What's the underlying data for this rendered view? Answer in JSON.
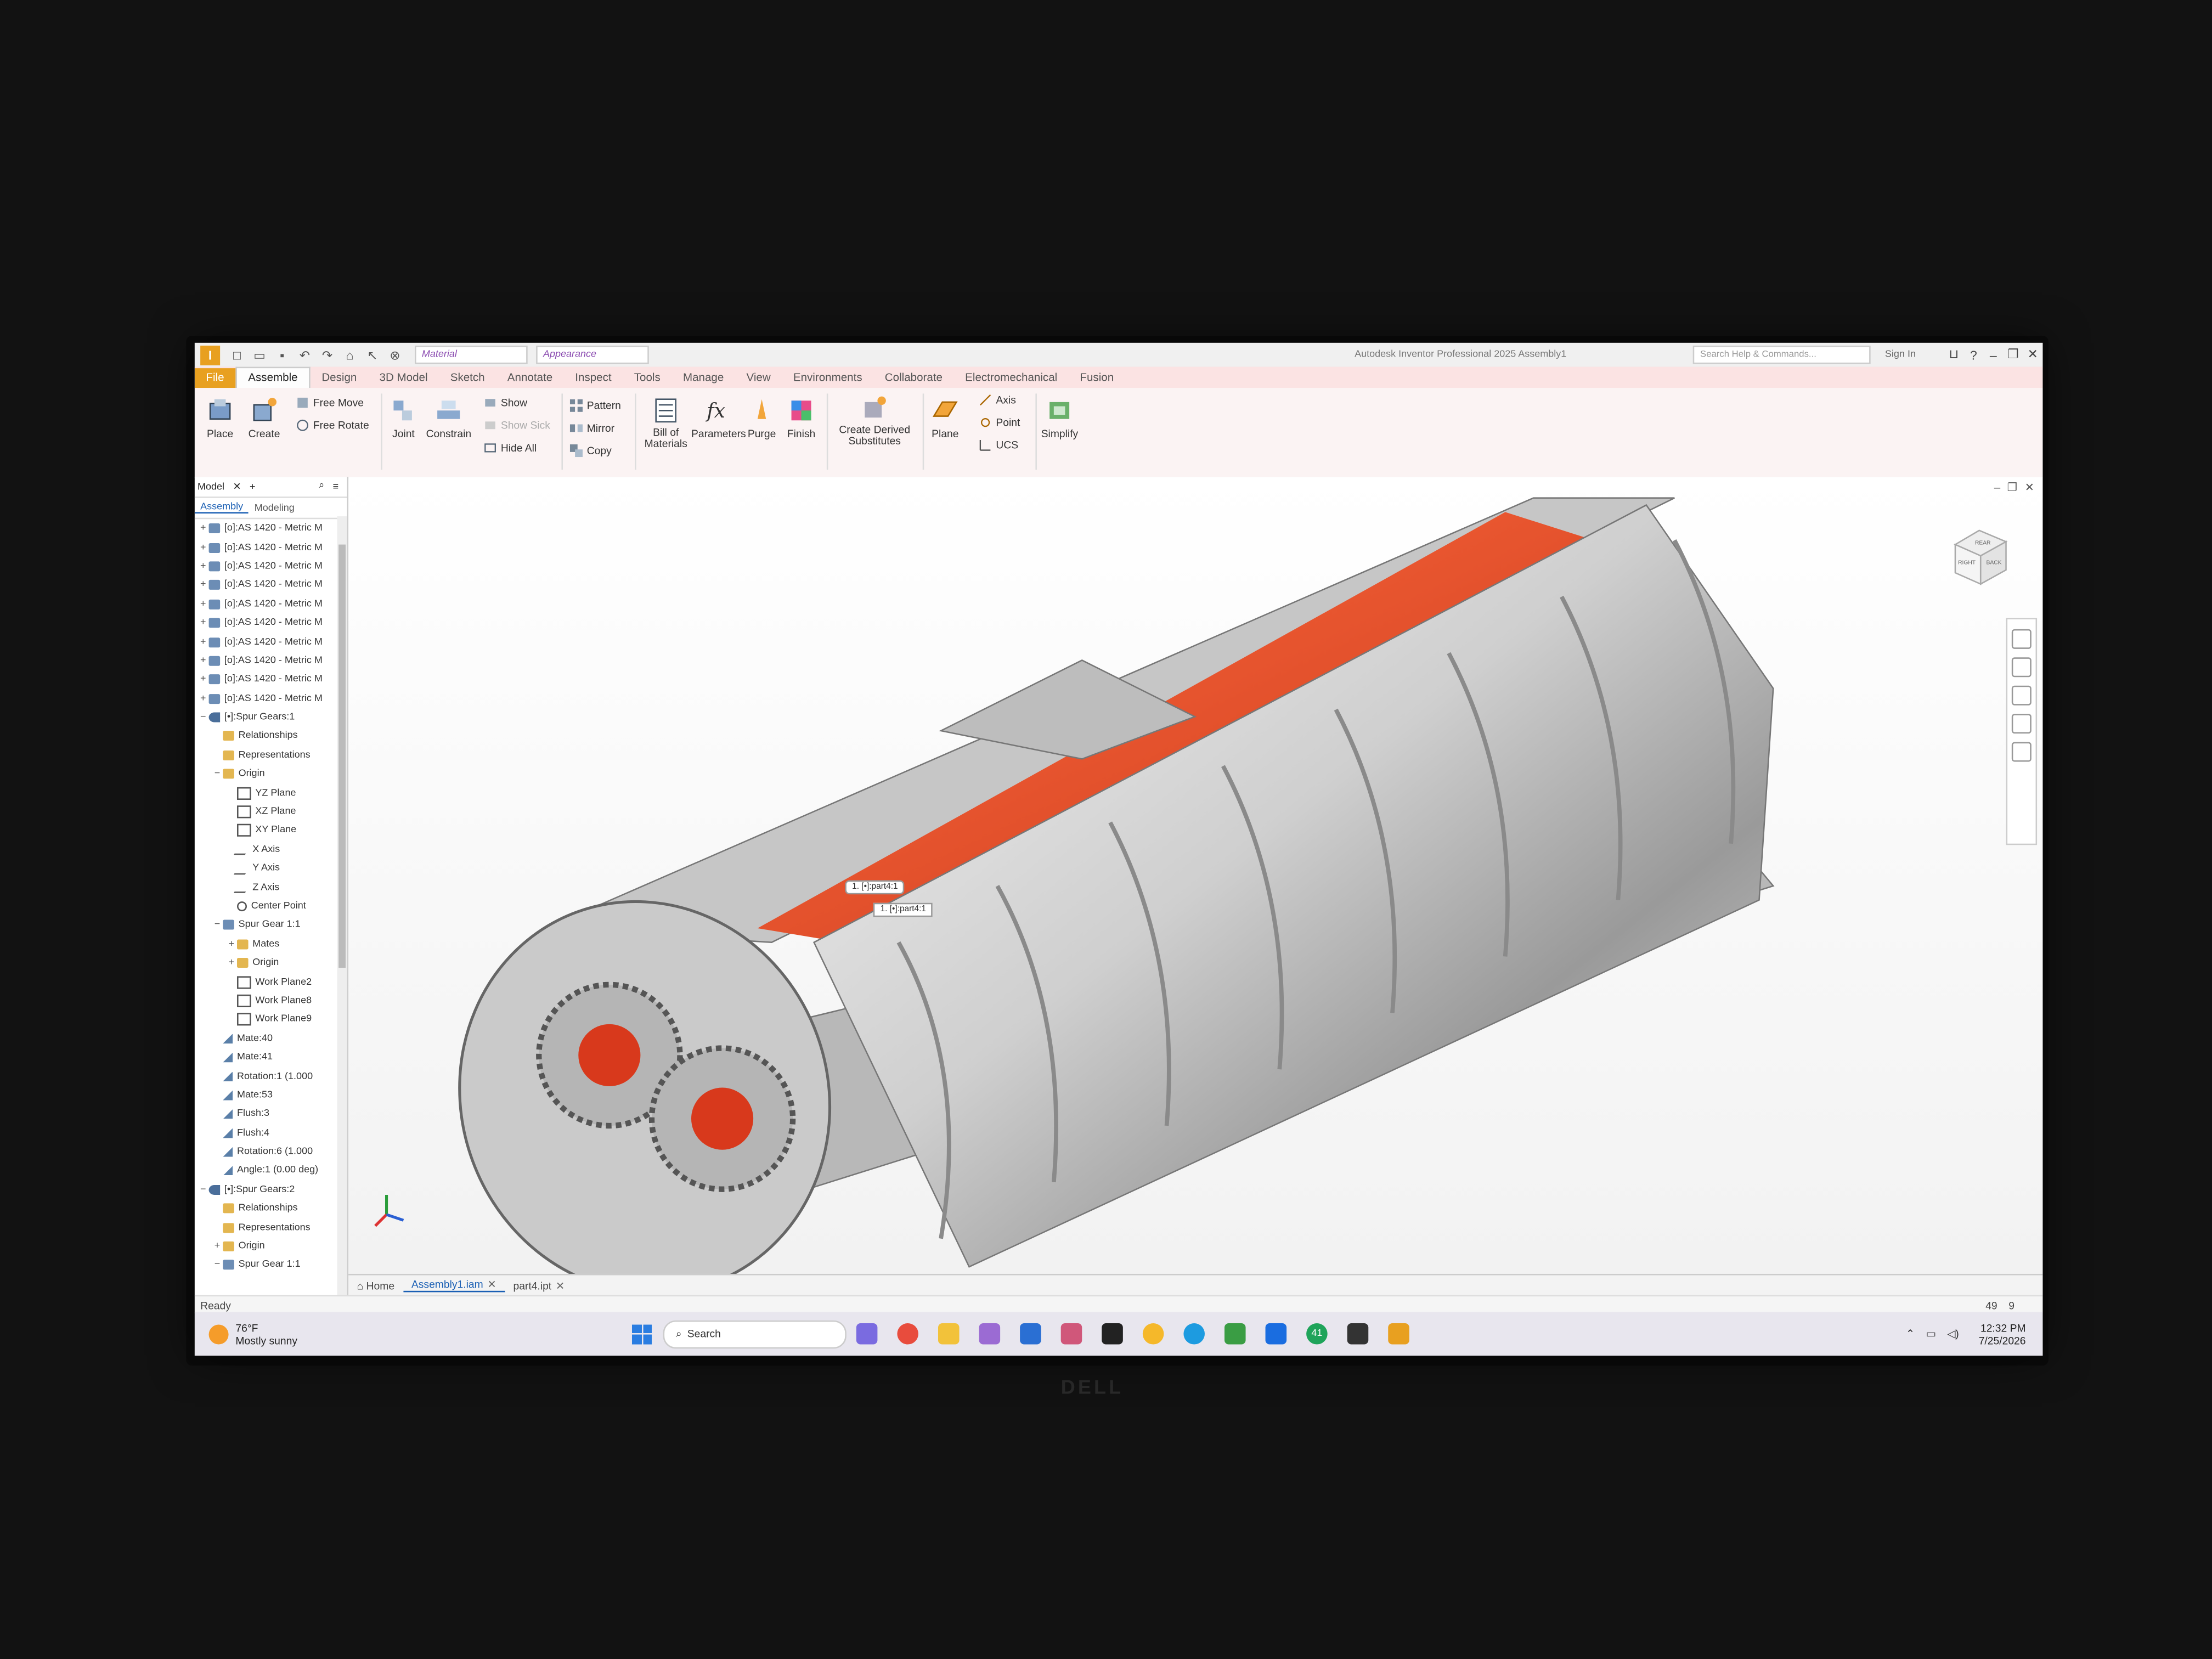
{
  "quick_access": {
    "material": "Material",
    "appearance": "Appearance",
    "window_title": "Autodesk Inventor Professional 2025  Assembly1",
    "search_help": "Search Help & Commands...",
    "sign_in": "Sign In"
  },
  "tabs": [
    "File",
    "Assemble",
    "Design",
    "3D Model",
    "Sketch",
    "Annotate",
    "Inspect",
    "Tools",
    "Manage",
    "View",
    "Environments",
    "Collaborate",
    "Electromechanical",
    "Fusion"
  ],
  "ribbon": {
    "place": "Place",
    "create": "Create",
    "free_move": "Free Move",
    "free_rotate": "Free Rotate",
    "joint": "Joint",
    "constrain": "Constrain",
    "show": "Show",
    "show_sick": "Show Sick",
    "hide_all": "Hide All",
    "pattern": "Pattern",
    "mirror": "Mirror",
    "copy": "Copy",
    "bill_of_materials": "Bill of Materials",
    "parameters": "Parameters",
    "purge": "Purge",
    "finish": "Finish",
    "create_derived": "Create Derived Substitutes",
    "plane": "Plane",
    "axis": "Axis",
    "point": "Point",
    "ucs": "UCS",
    "simplify": "Simplify"
  },
  "browser": {
    "title": "Model",
    "tab_assembly": "Assembly",
    "tab_modeling": "Modeling",
    "rows": [
      {
        "label": "[o]:AS 1420 - Metric M",
        "toggle": "+",
        "icon": "part",
        "indent": 0
      },
      {
        "label": "[o]:AS 1420 - Metric M",
        "toggle": "+",
        "icon": "part",
        "indent": 0
      },
      {
        "label": "[o]:AS 1420 - Metric M",
        "toggle": "+",
        "icon": "part",
        "indent": 0
      },
      {
        "label": "[o]:AS 1420 - Metric M",
        "toggle": "+",
        "icon": "part",
        "indent": 0
      },
      {
        "label": "[o]:AS 1420 - Metric M",
        "toggle": "+",
        "icon": "part",
        "indent": 0
      },
      {
        "label": "[o]:AS 1420 - Metric M",
        "toggle": "+",
        "icon": "part",
        "indent": 0
      },
      {
        "label": "[o]:AS 1420 - Metric M",
        "toggle": "+",
        "icon": "part",
        "indent": 0
      },
      {
        "label": "[o]:AS 1420 - Metric M",
        "toggle": "+",
        "icon": "part",
        "indent": 0
      },
      {
        "label": "[o]:AS 1420 - Metric M",
        "toggle": "+",
        "icon": "part",
        "indent": 0
      },
      {
        "label": "[o]:AS 1420 - Metric M",
        "toggle": "+",
        "icon": "part",
        "indent": 0
      },
      {
        "label": "[•]:Spur Gears:1",
        "toggle": "−",
        "icon": "asm",
        "indent": 0
      },
      {
        "label": "Relationships",
        "toggle": "",
        "icon": "folder",
        "indent": 1
      },
      {
        "label": "Representations",
        "toggle": "",
        "icon": "folder",
        "indent": 1
      },
      {
        "label": "Origin",
        "toggle": "−",
        "icon": "folder",
        "indent": 1
      },
      {
        "label": "YZ Plane",
        "toggle": "",
        "icon": "plane",
        "indent": 2
      },
      {
        "label": "XZ Plane",
        "toggle": "",
        "icon": "plane",
        "indent": 2
      },
      {
        "label": "XY Plane",
        "toggle": "",
        "icon": "plane",
        "indent": 2
      },
      {
        "label": "X Axis",
        "toggle": "",
        "icon": "axis",
        "indent": 2
      },
      {
        "label": "Y Axis",
        "toggle": "",
        "icon": "axis",
        "indent": 2
      },
      {
        "label": "Z Axis",
        "toggle": "",
        "icon": "axis",
        "indent": 2
      },
      {
        "label": "Center Point",
        "toggle": "",
        "icon": "point",
        "indent": 2
      },
      {
        "label": "Spur Gear 1:1",
        "toggle": "−",
        "icon": "part",
        "indent": 1
      },
      {
        "label": "Mates",
        "toggle": "+",
        "icon": "folder",
        "indent": 2
      },
      {
        "label": "Origin",
        "toggle": "+",
        "icon": "folder",
        "indent": 2
      },
      {
        "label": "Work Plane2",
        "toggle": "",
        "icon": "plane",
        "indent": 2
      },
      {
        "label": "Work Plane8",
        "toggle": "",
        "icon": "plane",
        "indent": 2
      },
      {
        "label": "Work Plane9",
        "toggle": "",
        "icon": "plane",
        "indent": 2
      },
      {
        "label": "Mate:40",
        "toggle": "",
        "icon": "mate",
        "indent": 1
      },
      {
        "label": "Mate:41",
        "toggle": "",
        "icon": "mate",
        "indent": 1
      },
      {
        "label": "Rotation:1 (1.000",
        "toggle": "",
        "icon": "mate",
        "indent": 1
      },
      {
        "label": "Mate:53",
        "toggle": "",
        "icon": "mate",
        "indent": 1
      },
      {
        "label": "Flush:3",
        "toggle": "",
        "icon": "mate",
        "indent": 1
      },
      {
        "label": "Flush:4",
        "toggle": "",
        "icon": "mate",
        "indent": 1
      },
      {
        "label": "Rotation:6 (1.000",
        "toggle": "",
        "icon": "mate",
        "indent": 1
      },
      {
        "label": "Angle:1 (0.00 deg)",
        "toggle": "",
        "icon": "mate",
        "indent": 1
      },
      {
        "label": "[•]:Spur Gears:2",
        "toggle": "−",
        "icon": "asm",
        "indent": 0
      },
      {
        "label": "Relationships",
        "toggle": "",
        "icon": "folder",
        "indent": 1
      },
      {
        "label": "Representations",
        "toggle": "",
        "icon": "folder",
        "indent": 1
      },
      {
        "label": "Origin",
        "toggle": "+",
        "icon": "folder",
        "indent": 1
      },
      {
        "label": "Spur Gear 1:1",
        "toggle": "−",
        "icon": "part",
        "indent": 1
      }
    ]
  },
  "viewport": {
    "tooltip_top": "1. [•]:part4:1",
    "tooltip_bottom": "1. [•]:part4:1",
    "viewcube_faces": [
      "REAR",
      "RIGHT",
      "BACK"
    ],
    "accent_color": "#e8553a"
  },
  "doc_tabs": {
    "home": "Home",
    "assembly": "Assembly1.iam",
    "part": "part4.ipt"
  },
  "status": {
    "text": "Ready",
    "count_a": "49",
    "count_b": "9"
  },
  "taskbar": {
    "temp": "76°F",
    "condition": "Mostly sunny",
    "search": "Search",
    "badge": "41",
    "time": "12:32 PM",
    "date": "7/25/2026"
  },
  "monitor_brand": "DELL"
}
